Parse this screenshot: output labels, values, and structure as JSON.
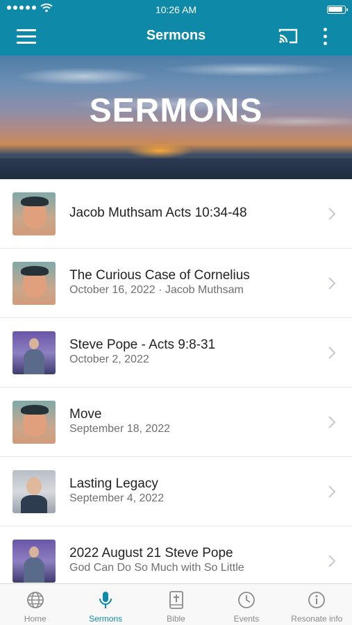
{
  "status": {
    "time": "10:26 AM"
  },
  "header": {
    "title": "Sermons"
  },
  "hero": {
    "title": "SERMONS"
  },
  "sermons": [
    {
      "title": "Jacob Muthsam Acts 10:34-48",
      "subtitle": ""
    },
    {
      "title": "The Curious Case of Cornelius",
      "subtitle": "October 16, 2022 · Jacob Muthsam"
    },
    {
      "title": "Steve Pope - Acts 9:8-31",
      "subtitle": "October 2, 2022"
    },
    {
      "title": "Move",
      "subtitle": "September 18, 2022"
    },
    {
      "title": "Lasting Legacy",
      "subtitle": "September 4, 2022"
    },
    {
      "title": "2022 August 21 Steve Pope",
      "subtitle": "God Can Do So Much with So Little"
    }
  ],
  "tabs": [
    {
      "label": "Home",
      "icon": "globe-icon"
    },
    {
      "label": "Sermons",
      "icon": "microphone-icon",
      "active": true
    },
    {
      "label": "Bible",
      "icon": "bible-icon"
    },
    {
      "label": "Events",
      "icon": "clock-icon"
    },
    {
      "label": "Resonate info",
      "icon": "info-icon"
    }
  ],
  "colors": {
    "brand": "#0e8aa8",
    "tab_inactive": "#8a8a8a",
    "chevron": "#c7c7cc"
  }
}
